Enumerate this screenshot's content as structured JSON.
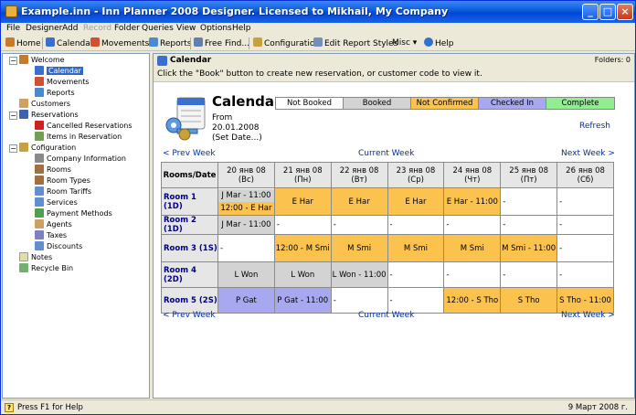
{
  "window": {
    "title": "Example.inn - Inn Planner 2008 Designer. Licensed to Mikhail, My Company"
  },
  "menu": [
    "File",
    "Designer",
    "Add",
    "Record",
    "Folder",
    "Queries",
    "View",
    "Options",
    "Help"
  ],
  "toolbar": {
    "home": "Home",
    "calendar": "Calendar",
    "movements": "Movements",
    "reports": "Reports",
    "free_find": "Free Find...",
    "configuration": "Configuration",
    "edit_report_styles": "Edit Report Styles",
    "misc": "Misc",
    "help": "Help"
  },
  "tree": {
    "welcome": "Welcome",
    "calendar": "Calendar",
    "movements": "Movements",
    "reports": "Reports",
    "customers": "Customers",
    "reservations": "Reservations",
    "cancelled_reservations": "Cancelled Reservations",
    "items_in_reservation": "Items in Reservation",
    "configuration": "Cofiguration",
    "company_information": "Company Information",
    "rooms": "Rooms",
    "room_types": "Room Types",
    "room_tariffs": "Room Tariffs",
    "services": "Services",
    "payment_methods": "Payment Methods",
    "agents": "Agents",
    "taxes": "Taxes",
    "discounts": "Discounts",
    "notes": "Notes",
    "recycle_bin": "Recycle Bin"
  },
  "header": {
    "title": "Calendar",
    "folders": "Folders: 0"
  },
  "hint": "Click the \"Book\" button to create new reservation, or customer code to view it.",
  "calendar": {
    "title": "Calendar",
    "from_label": "From",
    "from_date": "20.01.2008",
    "set_date": "(Set Date...)",
    "refresh": "Refresh",
    "prev_week": "< Prev Week",
    "current_week": "Current Week",
    "next_week": "Next Week >"
  },
  "legend": {
    "not_booked": "Not Booked",
    "booked": "Booked",
    "not_confirmed": "Not Confirmed",
    "checked_in": "Checked In",
    "complete": "Complete"
  },
  "grid": {
    "corner": "Rooms/Date",
    "days": [
      {
        "date": "20 янв 08",
        "dow": "(Вс)"
      },
      {
        "date": "21 янв 08",
        "dow": "(Пн)"
      },
      {
        "date": "22 янв 08",
        "dow": "(Вт)"
      },
      {
        "date": "23 янв 08",
        "dow": "(Ср)"
      },
      {
        "date": "24 янв 08",
        "dow": "(Чт)"
      },
      {
        "date": "25 янв 08",
        "dow": "(Пт)"
      },
      {
        "date": "26 янв 08",
        "dow": "(Сб)"
      }
    ],
    "rooms": [
      {
        "label": "Room 1 (1D)",
        "cells": [
          {
            "text": "J Mar - 11:00",
            "text2": "12:00 - E Har",
            "status": "split"
          },
          {
            "text": "E Har",
            "status": "not_confirmed"
          },
          {
            "text": "E Har",
            "status": "not_confirmed"
          },
          {
            "text": "E Har",
            "status": "not_confirmed"
          },
          {
            "text": "E Har - 11:00",
            "status": "not_confirmed"
          },
          {
            "text": "-",
            "status": "free"
          },
          {
            "text": "-",
            "status": "free"
          }
        ]
      },
      {
        "label": "Room 2 (1D)",
        "cells": [
          {
            "text": "J Mar - 11:00",
            "status": "booked"
          },
          {
            "text": "-",
            "status": "free"
          },
          {
            "text": "-",
            "status": "free"
          },
          {
            "text": "-",
            "status": "free"
          },
          {
            "text": "-",
            "status": "free"
          },
          {
            "text": "-",
            "status": "free"
          },
          {
            "text": "-",
            "status": "free"
          }
        ]
      },
      {
        "label": "Room 3 (1S)",
        "cells": [
          {
            "text": "-",
            "status": "free"
          },
          {
            "text": "12:00 - M Smi",
            "status": "not_confirmed"
          },
          {
            "text": "M Smi",
            "status": "not_confirmed"
          },
          {
            "text": "M Smi",
            "status": "not_confirmed"
          },
          {
            "text": "M Smi",
            "status": "not_confirmed"
          },
          {
            "text": "M Smi - 11:00",
            "status": "not_confirmed"
          },
          {
            "text": "-",
            "status": "free"
          }
        ]
      },
      {
        "label": "Room 4 (2D)",
        "cells": [
          {
            "text": "L Won",
            "status": "booked"
          },
          {
            "text": "L Won",
            "status": "booked"
          },
          {
            "text": "L Won - 11:00",
            "status": "booked"
          },
          {
            "text": "-",
            "status": "free"
          },
          {
            "text": "-",
            "status": "free"
          },
          {
            "text": "-",
            "status": "free"
          },
          {
            "text": "-",
            "status": "free"
          }
        ]
      },
      {
        "label": "Room 5 (2S)",
        "cells": [
          {
            "text": "P Gat",
            "status": "checked_in"
          },
          {
            "text": "P Gat - 11:00",
            "status": "checked_in"
          },
          {
            "text": "-",
            "status": "free"
          },
          {
            "text": "-",
            "status": "free"
          },
          {
            "text": "12:00 - S Tho",
            "status": "not_confirmed"
          },
          {
            "text": "S Tho",
            "status": "not_confirmed"
          },
          {
            "text": "S Tho - 11:00",
            "status": "not_confirmed"
          }
        ]
      }
    ]
  },
  "status": {
    "left": "Press F1 for Help",
    "right": "9 Март 2008 г."
  },
  "colors": {
    "not_booked": "#FFFFFF",
    "booked": "#D3D3D3",
    "not_confirmed": "#FCC24E",
    "checked_in": "#A8A8F0",
    "complete": "#90EE90"
  }
}
